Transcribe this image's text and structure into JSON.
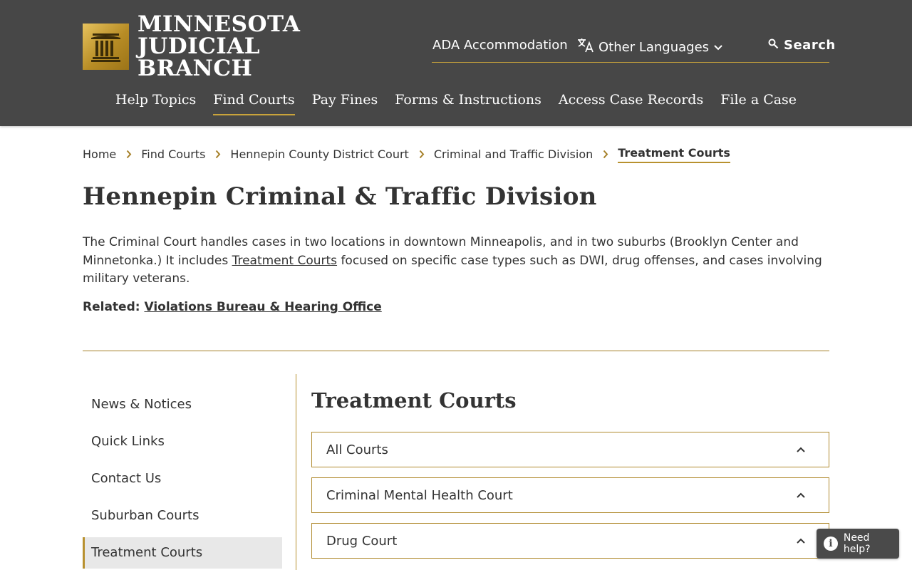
{
  "brand": {
    "line1": "MINNESOTA",
    "line2": "JUDICIAL BRANCH",
    "seal_icon": "courthouse-columns-icon"
  },
  "utility": {
    "ada": "ADA Accommodation",
    "languages": "Other Languages",
    "search": "Search"
  },
  "nav": [
    {
      "label": "Help Topics"
    },
    {
      "label": "Find Courts"
    },
    {
      "label": "Pay Fines"
    },
    {
      "label": "Forms & Instructions"
    },
    {
      "label": "Access Case Records"
    },
    {
      "label": "File a Case"
    }
  ],
  "breadcrumb": [
    {
      "label": "Home"
    },
    {
      "label": "Find Courts"
    },
    {
      "label": "Hennepin County District Court"
    },
    {
      "label": "Criminal and Traffic Division"
    },
    {
      "label": "Treatment Courts"
    }
  ],
  "page": {
    "title": "Hennepin Criminal & Traffic Division",
    "intro_a": "The Criminal Court handles cases in two locations in downtown Minneapolis, and in two suburbs (Brooklyn Center and Minnetonka.) It includes ",
    "intro_link": "Treatment Courts",
    "intro_b": " focused on specific case types such as DWI, drug offenses, and cases involving military veterans.",
    "related_label": "Related: ",
    "related_link": "Violations Bureau & Hearing Office"
  },
  "sidebar": [
    {
      "label": "News & Notices"
    },
    {
      "label": "Quick Links"
    },
    {
      "label": "Contact Us"
    },
    {
      "label": "Suburban Courts"
    },
    {
      "label": "Treatment Courts"
    }
  ],
  "content": {
    "title": "Treatment Courts",
    "accordion": [
      {
        "label": "All Courts"
      },
      {
        "label": "Criminal Mental Health Court"
      },
      {
        "label": "Drug Court"
      }
    ]
  },
  "help": {
    "label": "Need help?",
    "icon_glyph": "i"
  },
  "colors": {
    "header_bg": "#474747",
    "accent_gold": "#b8912f"
  }
}
